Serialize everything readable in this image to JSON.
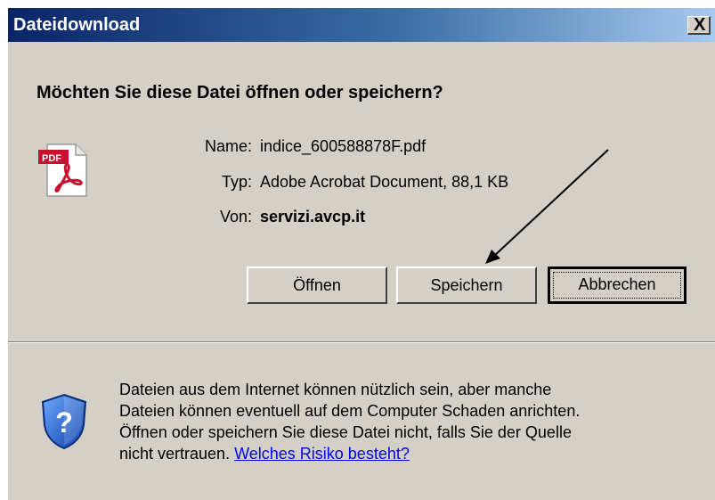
{
  "window": {
    "title": "Dateidownload",
    "close_label": "X"
  },
  "dialog": {
    "question": "Möchten Sie diese Datei öffnen oder speichern?",
    "file_icon": "pdf-icon",
    "fields": {
      "name_label": "Name:",
      "name_value": "indice_600588878F.pdf",
      "type_label": "Typ:",
      "type_value": "Adobe Acrobat Document, 88,1 KB",
      "from_label": "Von:",
      "from_value": "servizi.avcp.it"
    },
    "buttons": {
      "open": "Öffnen",
      "save": "Speichern",
      "cancel": "Abbrechen"
    }
  },
  "warning": {
    "icon": "shield-question-icon",
    "line1": "Dateien aus dem Internet können nützlich sein, aber manche",
    "line2": "Dateien können eventuell auf dem Computer Schaden anrichten.",
    "line3": "Öffnen oder speichern Sie diese Datei nicht, falls Sie der Quelle",
    "line4_prefix": "nicht vertrauen.",
    "link": "Welches Risiko besteht?"
  },
  "colors": {
    "titlebar_start": "#0a246a",
    "titlebar_end": "#a6caf0",
    "dialog_bg": "#d4d0c8",
    "link": "#0000ee"
  }
}
